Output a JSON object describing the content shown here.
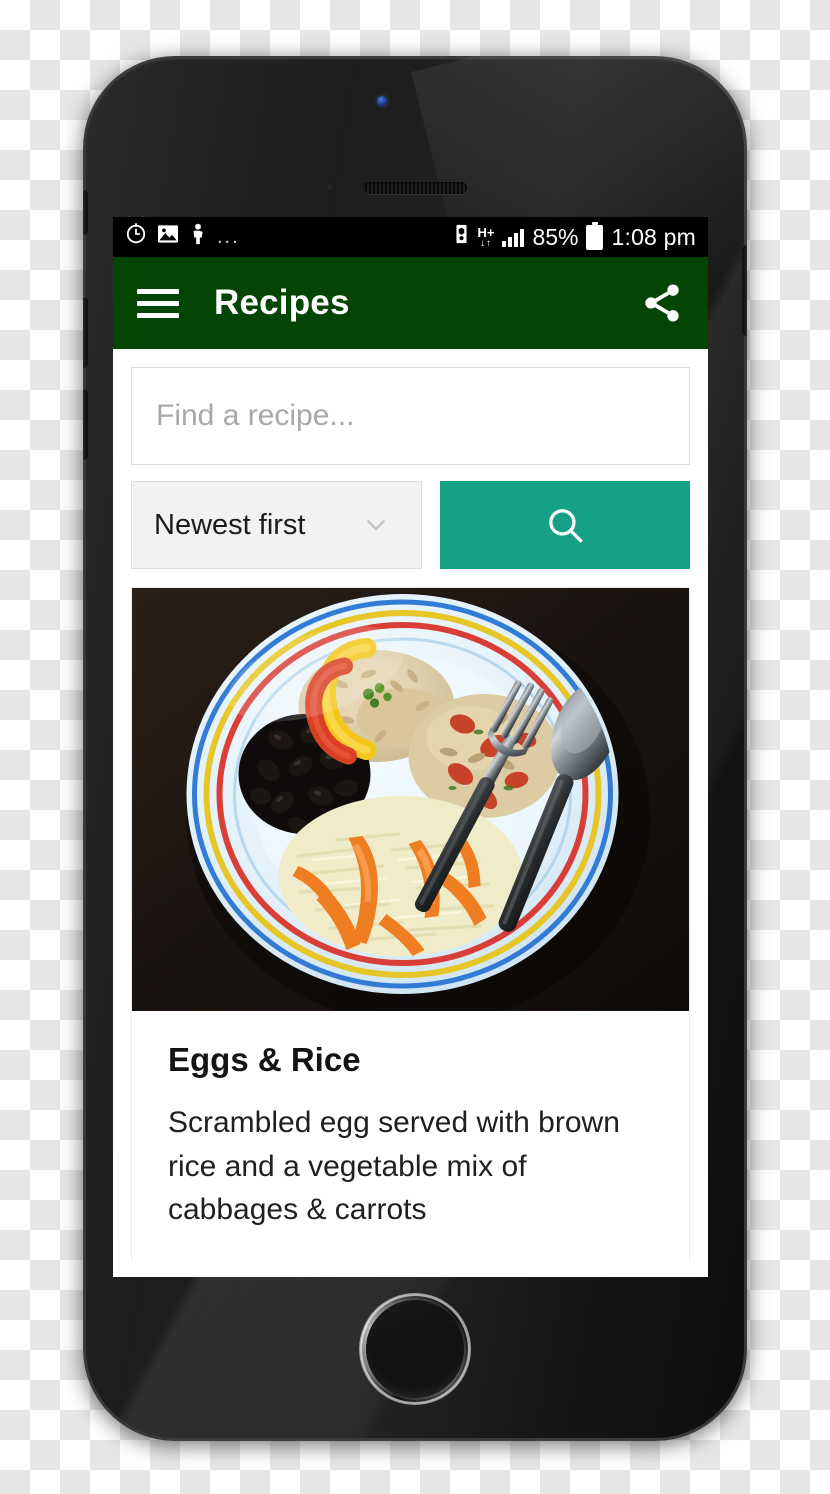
{
  "statusbar": {
    "icons_left": [
      "alarm-icon",
      "image-icon",
      "person-icon"
    ],
    "overflow_dots": "...",
    "icons_right": [
      "battery-saver-icon",
      "hplus-network-icon",
      "signal-icon"
    ],
    "network_label": "H+",
    "network_sub": "↓↑",
    "battery_percent": "85%",
    "time": "1:08 pm"
  },
  "appbar": {
    "menu_icon": "hamburger-menu-icon",
    "title": "Recipes",
    "share_icon": "share-icon",
    "background": "#044504"
  },
  "search": {
    "placeholder": "Find a recipe...",
    "value": "",
    "sort_selected": "Newest first",
    "sort_chevron": "chevron-down-icon",
    "button_icon": "search-icon",
    "button_color": "#16a085"
  },
  "recipe_card": {
    "image_alt": "plate-of-eggs-and-rice",
    "title": "Eggs & Rice",
    "description": "Scrambled egg served with brown rice and a vegetable mix of cabbages & carrots"
  }
}
